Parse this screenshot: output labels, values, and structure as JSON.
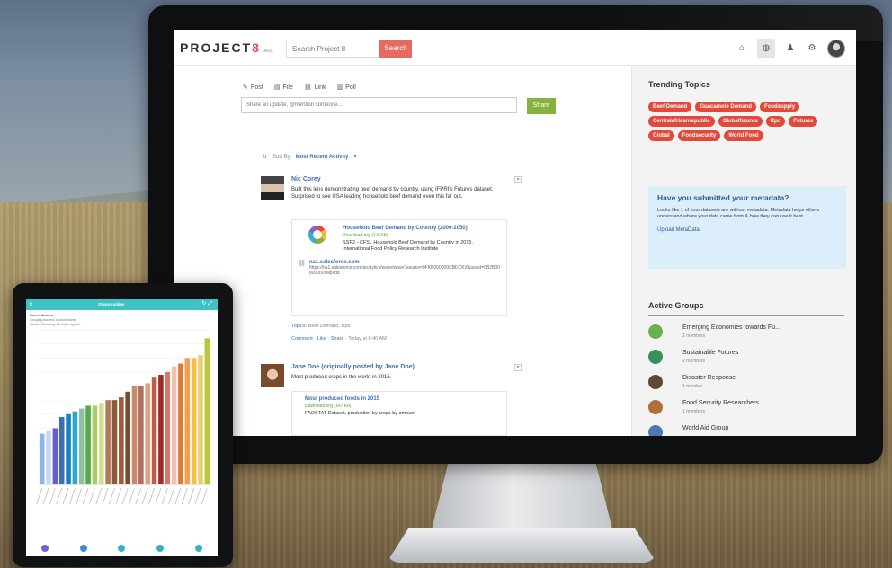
{
  "app": {
    "logo_text": "PROJECT",
    "logo_num": "8",
    "logo_beta": "beta"
  },
  "search": {
    "placeholder": "Search Project 8",
    "button": "Search"
  },
  "nav": {
    "icons": [
      "home-icon",
      "globe-icon",
      "user-icon",
      "gear-icon"
    ]
  },
  "composer": {
    "tabs": [
      {
        "icon": "✎",
        "label": "Post"
      },
      {
        "icon": "▤",
        "label": "File"
      },
      {
        "icon": "⛓",
        "label": "Link"
      },
      {
        "icon": "▥",
        "label": "Poll"
      }
    ],
    "placeholder": "Share an update, @mention someone...",
    "share": "Share"
  },
  "sort": {
    "prefix": "Sort By",
    "value": "Most Recent Activity"
  },
  "posts": [
    {
      "author": "Nic Corey",
      "text": "Built this lens demonstrating beef demand by country, using IFPRI's Futures dataset. Surprised to see USA leading household beef demand even this far out.",
      "card_title": "Household Beef Demand by Country (2000-2050)",
      "card_source": "Download.org (1.5 Kb)",
      "card_desc": "SSP2 - CFSL Household Beef Demand by Country in 2015. International Food Policy Research Institute",
      "link_title": "na1.salesforce.com",
      "link_url": "https://na1.salesforce.com/analytics/wave/wave?source=0FKB000000CBDCKX&asset=0B2B00000000swpxdb",
      "topics_label": "Topics",
      "topics": "Beef Demand, Rpd",
      "actions": [
        "Comment",
        "Like",
        "Share"
      ],
      "time": "Today at 8:40 AM"
    },
    {
      "author": "Jane Doe (originally posted by Jane Doe)",
      "text": "Most produced crops in the world in 2015.",
      "card_title": "Most produced foods in 2015",
      "card_source": "Download.org (147 Kb)",
      "card_desc": "FAOSTAT Dataset, production by crops by amount"
    }
  ],
  "trending": {
    "title": "Trending Topics",
    "tags": [
      "Beef Demand",
      "Guacamole Demand",
      "Foodsupply",
      "Centralafricanrepublic",
      "Globalfutures",
      "Rpd",
      "Futures",
      "Global",
      "Foodsecurity",
      "World Food"
    ]
  },
  "metadata": {
    "title": "Have you submitted your metadata?",
    "text": "Looks like 1 of your datasets are without metadata. Metadata helps others understand where your data came from & how they can use it best.",
    "link": "Upload MetaData"
  },
  "groups": {
    "title": "Active Groups",
    "items": [
      {
        "name": "Emerging Economies towards Fu...",
        "members": "2 members",
        "color": "#6ab04c"
      },
      {
        "name": "Sustainable Futures",
        "members": "2 members",
        "color": "#3a8f5a"
      },
      {
        "name": "Disaster Response",
        "members": "1 member",
        "color": "#5a4a3a"
      },
      {
        "name": "Food Security Researchers",
        "members": "1 members",
        "color": "#b0703a"
      },
      {
        "name": "World Aid Group",
        "members": "",
        "color": "#4a7ab0"
      }
    ]
  },
  "tablet": {
    "title": "Opportunities",
    "label_top": "Sum of Amount",
    "label_line2": "Grouping Ascend: Account Name",
    "label_line3": "Stacked Grouping: No Value applied"
  },
  "chart_data": {
    "type": "bar",
    "title": "Sum of Amount",
    "values": [
      18,
      19,
      20,
      24,
      25,
      26,
      27,
      28,
      28,
      29,
      30,
      30,
      31,
      33,
      35,
      35,
      36,
      38,
      39,
      40,
      42,
      43,
      45,
      45,
      46,
      52
    ],
    "colors": [
      "#8fb4e8",
      "#c9d8f2",
      "#6a5fc9",
      "#3a6fb0",
      "#1c7ec0",
      "#2aa9c0",
      "#8ec1a0",
      "#5aa84c",
      "#a9cc6a",
      "#d4de8c",
      "#b07a5a",
      "#8a5a3a",
      "#a05a3a",
      "#7a4a30",
      "#c88a6a",
      "#b07060",
      "#e0a080",
      "#c05a4a",
      "#a02a2a",
      "#d07a6a",
      "#f0c0b0",
      "#e07a30",
      "#f0a050",
      "#f4c040",
      "#e8d070",
      "#b8c83a"
    ]
  }
}
